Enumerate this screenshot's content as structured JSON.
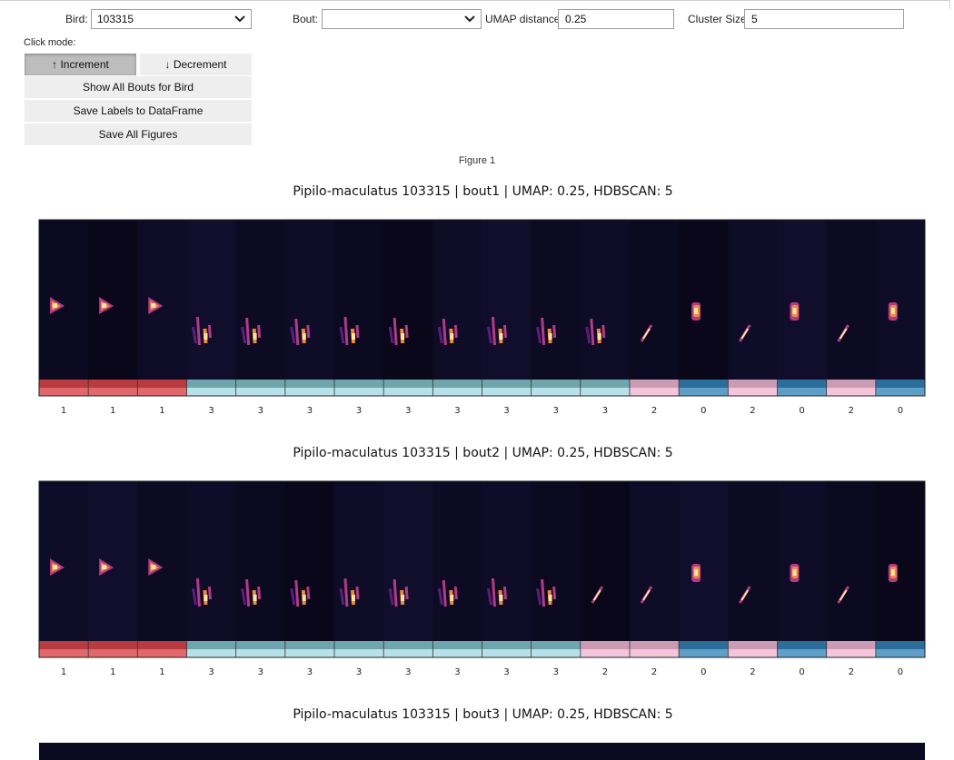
{
  "controls": {
    "bird_label": "Bird:",
    "bird_value": "103315",
    "bout_label": "Bout:",
    "bout_value": "",
    "umap_label": "UMAP distance",
    "umap_value": "0.25",
    "cluster_label": "Cluster Size",
    "cluster_value": "5",
    "click_mode_label": "Click mode:",
    "increment_label": "↑ Increment",
    "decrement_label": "↓ Decrement",
    "active_mode": "increment",
    "show_all_label": "Show All Bouts for Bird",
    "save_labels_label": "Save Labels to DataFrame",
    "save_figures_label": "Save All Figures"
  },
  "figure": {
    "title": "Figure 1",
    "panels": [
      {
        "title": "Pipilo-maculatus 103315 | bout1 | UMAP: 0.25, HDBSCAN: 5",
        "labels": [
          "1",
          "1",
          "1",
          "3",
          "3",
          "3",
          "3",
          "3",
          "3",
          "3",
          "3",
          "3",
          "2",
          "0",
          "2",
          "0",
          "2",
          "0"
        ]
      },
      {
        "title": "Pipilo-maculatus 103315 | bout2 | UMAP: 0.25, HDBSCAN: 5",
        "labels": [
          "1",
          "1",
          "1",
          "3",
          "3",
          "3",
          "3",
          "3",
          "3",
          "3",
          "3",
          "2",
          "2",
          "0",
          "2",
          "0",
          "2",
          "0"
        ]
      },
      {
        "title": "Pipilo-maculatus 103315 | bout3 | UMAP: 0.25, HDBSCAN: 5",
        "labels": []
      }
    ]
  },
  "cluster_colors": {
    "0": {
      "top": "#2b6e9c",
      "bottom": "#5f9ec7"
    },
    "1": {
      "top": "#b83b40",
      "bottom": "#e0676a"
    },
    "2": {
      "top": "#cb9bb4",
      "bottom": "#f3c4da"
    },
    "3": {
      "top": "#6fa5ad",
      "bottom": "#b7e1e8"
    }
  },
  "syllable_shapes": {
    "0": "blob",
    "1": "chevron",
    "2": "slash",
    "3": "complex"
  }
}
